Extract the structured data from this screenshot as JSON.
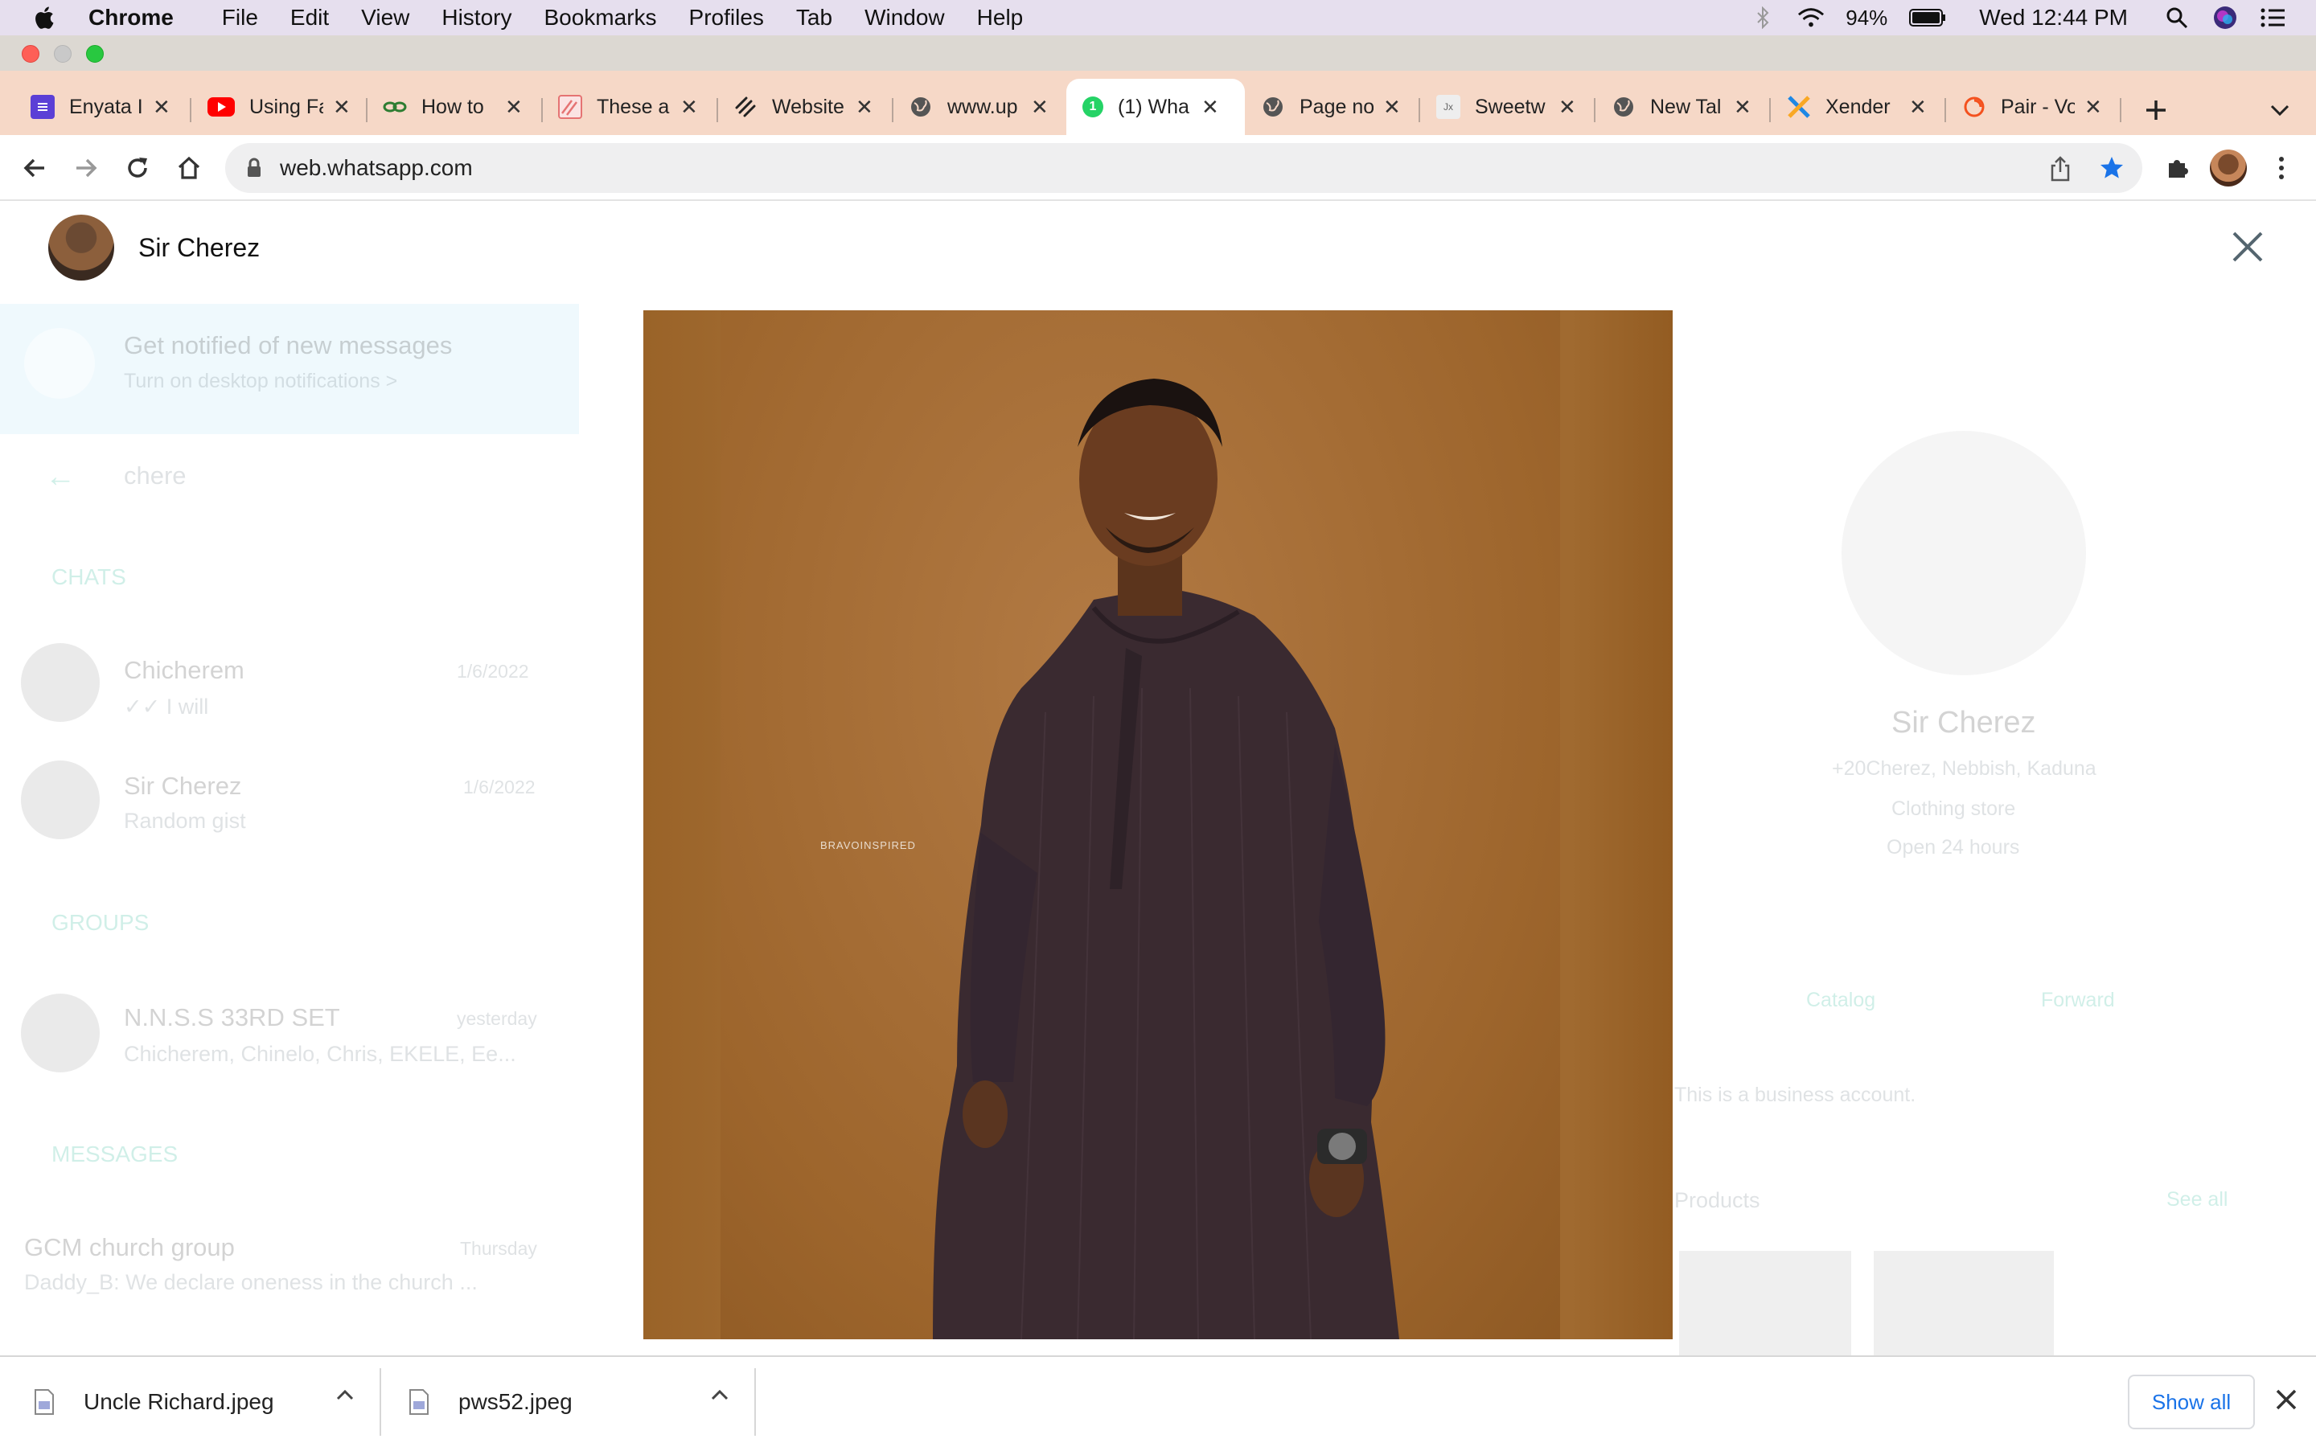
{
  "menubar": {
    "app": "Chrome",
    "items": [
      "File",
      "Edit",
      "View",
      "History",
      "Bookmarks",
      "Profiles",
      "Tab",
      "Window",
      "Help"
    ],
    "battery": "94%",
    "clock": "Wed 12:44 PM"
  },
  "tabs": [
    {
      "label": "Enyata I",
      "icon": "form-icon",
      "color": "#5b3fd6"
    },
    {
      "label": "Using Fa",
      "icon": "youtube-icon",
      "color": "#ff0000"
    },
    {
      "label": "How to",
      "icon": "link-icon",
      "color": "#2e7d32"
    },
    {
      "label": "These a",
      "icon": "stripes-icon",
      "color": "#e57373"
    },
    {
      "label": "Website",
      "icon": "squarespace-icon",
      "color": "#222222"
    },
    {
      "label": "www.up",
      "icon": "globe-icon",
      "color": "#444444"
    },
    {
      "label": "(1) Wha",
      "icon": "whatsapp-icon",
      "color": "#25d366",
      "active": true
    },
    {
      "label": "Page no",
      "icon": "globe-icon",
      "color": "#444444"
    },
    {
      "label": "Sweetw",
      "icon": "image-icon",
      "color": "#888888"
    },
    {
      "label": "New Tal",
      "icon": "globe-icon",
      "color": "#444444"
    },
    {
      "label": "Xender",
      "icon": "xender-icon",
      "color": "#1e88e5"
    },
    {
      "label": "Pair - Vo",
      "icon": "pair-icon",
      "color": "#f4511e"
    }
  ],
  "omnibox": {
    "url": "web.whatsapp.com"
  },
  "viewer": {
    "contact_name": "Sir Cherez",
    "watermark": "BRAVOINSPIRED"
  },
  "background": {
    "notify_title": "Get notified of new messages",
    "notify_sub": "Turn on desktop notifications >",
    "search_value": "chere",
    "section_chats": "CHATS",
    "chats": [
      {
        "name": "Chicherem",
        "date": "1/6/2022",
        "preview": "✓✓ I will"
      },
      {
        "name": "Sir Cherez",
        "date": "1/6/2022",
        "preview": "Random gist"
      }
    ],
    "section_groups": "GROUPS",
    "group": {
      "name": "N.N.S.S 33RD SET",
      "date": "yesterday",
      "preview": "Chicherem, Chinelo, Chris, EKELE, Ee..."
    },
    "section_messages": "MESSAGES",
    "message": {
      "name": "GCM church group",
      "date": "Thursday",
      "preview": "Daddy_B: We declare oneness in the church ..."
    },
    "profile": {
      "name": "Sir Cherez",
      "location": "+20Cherez, Nebbish, Kaduna",
      "category": "Clothing store",
      "hours": "Open 24 hours",
      "catalog": "Catalog",
      "forward": "Forward",
      "business_note": "This is a business account.",
      "products": "Products",
      "see_all": "See all"
    }
  },
  "downloads": {
    "items": [
      {
        "name": "Uncle Richard.jpeg"
      },
      {
        "name": "pws52.jpeg"
      }
    ],
    "show_all": "Show all"
  }
}
